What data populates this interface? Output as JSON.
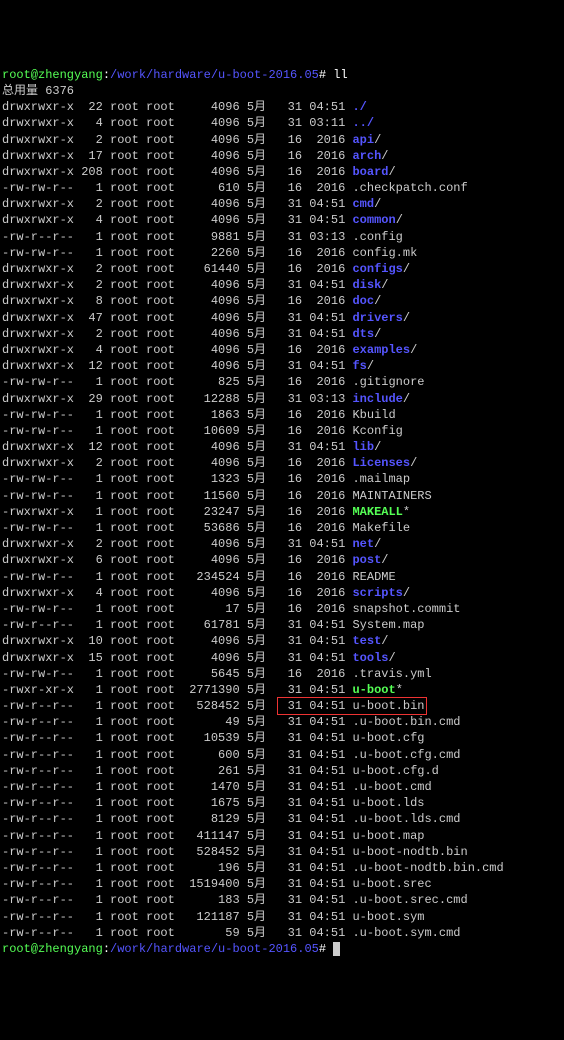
{
  "prompt": {
    "userhost": "root@zhengyang",
    "path": "/work/hardware/u-boot-2016.05",
    "cmd": "ll"
  },
  "total_label": "总用量 6376",
  "rows": [
    {
      "perm": "drwxrwxr-x",
      "links": "22",
      "owner": "root",
      "group": "root",
      "size": "4096",
      "mon": "5月",
      "day": "31",
      "time": "04:51",
      "name": "./",
      "cls": "blue"
    },
    {
      "perm": "drwxrwxr-x",
      "links": "4",
      "owner": "root",
      "group": "root",
      "size": "4096",
      "mon": "5月",
      "day": "31",
      "time": "03:11",
      "name": "../",
      "cls": "blue"
    },
    {
      "perm": "drwxrwxr-x",
      "links": "2",
      "owner": "root",
      "group": "root",
      "size": "4096",
      "mon": "5月",
      "day": "16",
      "time": "2016",
      "name": "api",
      "cls": "blue",
      "trail": "/"
    },
    {
      "perm": "drwxrwxr-x",
      "links": "17",
      "owner": "root",
      "group": "root",
      "size": "4096",
      "mon": "5月",
      "day": "16",
      "time": "2016",
      "name": "arch",
      "cls": "blue",
      "trail": "/"
    },
    {
      "perm": "drwxrwxr-x",
      "links": "208",
      "owner": "root",
      "group": "root",
      "size": "4096",
      "mon": "5月",
      "day": "16",
      "time": "2016",
      "name": "board",
      "cls": "blue",
      "trail": "/"
    },
    {
      "perm": "-rw-rw-r--",
      "links": "1",
      "owner": "root",
      "group": "root",
      "size": "610",
      "mon": "5月",
      "day": "16",
      "time": "2016",
      "name": ".checkpatch.conf",
      "cls": "gray"
    },
    {
      "perm": "drwxrwxr-x",
      "links": "2",
      "owner": "root",
      "group": "root",
      "size": "4096",
      "mon": "5月",
      "day": "31",
      "time": "04:51",
      "name": "cmd",
      "cls": "blue",
      "trail": "/"
    },
    {
      "perm": "drwxrwxr-x",
      "links": "4",
      "owner": "root",
      "group": "root",
      "size": "4096",
      "mon": "5月",
      "day": "31",
      "time": "04:51",
      "name": "common",
      "cls": "blue",
      "trail": "/"
    },
    {
      "perm": "-rw-r--r--",
      "links": "1",
      "owner": "root",
      "group": "root",
      "size": "9881",
      "mon": "5月",
      "day": "31",
      "time": "03:13",
      "name": ".config",
      "cls": "gray"
    },
    {
      "perm": "-rw-rw-r--",
      "links": "1",
      "owner": "root",
      "group": "root",
      "size": "2260",
      "mon": "5月",
      "day": "16",
      "time": "2016",
      "name": "config.mk",
      "cls": "gray"
    },
    {
      "perm": "drwxrwxr-x",
      "links": "2",
      "owner": "root",
      "group": "root",
      "size": "61440",
      "mon": "5月",
      "day": "16",
      "time": "2016",
      "name": "configs",
      "cls": "blue",
      "trail": "/"
    },
    {
      "perm": "drwxrwxr-x",
      "links": "2",
      "owner": "root",
      "group": "root",
      "size": "4096",
      "mon": "5月",
      "day": "31",
      "time": "04:51",
      "name": "disk",
      "cls": "blue",
      "trail": "/"
    },
    {
      "perm": "drwxrwxr-x",
      "links": "8",
      "owner": "root",
      "group": "root",
      "size": "4096",
      "mon": "5月",
      "day": "16",
      "time": "2016",
      "name": "doc",
      "cls": "blue",
      "trail": "/"
    },
    {
      "perm": "drwxrwxr-x",
      "links": "47",
      "owner": "root",
      "group": "root",
      "size": "4096",
      "mon": "5月",
      "day": "31",
      "time": "04:51",
      "name": "drivers",
      "cls": "blue",
      "trail": "/"
    },
    {
      "perm": "drwxrwxr-x",
      "links": "2",
      "owner": "root",
      "group": "root",
      "size": "4096",
      "mon": "5月",
      "day": "31",
      "time": "04:51",
      "name": "dts",
      "cls": "blue",
      "trail": "/"
    },
    {
      "perm": "drwxrwxr-x",
      "links": "4",
      "owner": "root",
      "group": "root",
      "size": "4096",
      "mon": "5月",
      "day": "16",
      "time": "2016",
      "name": "examples",
      "cls": "blue",
      "trail": "/"
    },
    {
      "perm": "drwxrwxr-x",
      "links": "12",
      "owner": "root",
      "group": "root",
      "size": "4096",
      "mon": "5月",
      "day": "31",
      "time": "04:51",
      "name": "fs",
      "cls": "blue",
      "trail": "/"
    },
    {
      "perm": "-rw-rw-r--",
      "links": "1",
      "owner": "root",
      "group": "root",
      "size": "825",
      "mon": "5月",
      "day": "16",
      "time": "2016",
      "name": ".gitignore",
      "cls": "gray"
    },
    {
      "perm": "drwxrwxr-x",
      "links": "29",
      "owner": "root",
      "group": "root",
      "size": "12288",
      "mon": "5月",
      "day": "31",
      "time": "03:13",
      "name": "include",
      "cls": "blue",
      "trail": "/"
    },
    {
      "perm": "-rw-rw-r--",
      "links": "1",
      "owner": "root",
      "group": "root",
      "size": "1863",
      "mon": "5月",
      "day": "16",
      "time": "2016",
      "name": "Kbuild",
      "cls": "gray"
    },
    {
      "perm": "-rw-rw-r--",
      "links": "1",
      "owner": "root",
      "group": "root",
      "size": "10609",
      "mon": "5月",
      "day": "16",
      "time": "2016",
      "name": "Kconfig",
      "cls": "gray"
    },
    {
      "perm": "drwxrwxr-x",
      "links": "12",
      "owner": "root",
      "group": "root",
      "size": "4096",
      "mon": "5月",
      "day": "31",
      "time": "04:51",
      "name": "lib",
      "cls": "blue",
      "trail": "/"
    },
    {
      "perm": "drwxrwxr-x",
      "links": "2",
      "owner": "root",
      "group": "root",
      "size": "4096",
      "mon": "5月",
      "day": "16",
      "time": "2016",
      "name": "Licenses",
      "cls": "blue",
      "trail": "/"
    },
    {
      "perm": "-rw-rw-r--",
      "links": "1",
      "owner": "root",
      "group": "root",
      "size": "1323",
      "mon": "5月",
      "day": "16",
      "time": "2016",
      "name": ".mailmap",
      "cls": "gray"
    },
    {
      "perm": "-rw-rw-r--",
      "links": "1",
      "owner": "root",
      "group": "root",
      "size": "11560",
      "mon": "5月",
      "day": "16",
      "time": "2016",
      "name": "MAINTAINERS",
      "cls": "gray"
    },
    {
      "perm": "-rwxrwxr-x",
      "links": "1",
      "owner": "root",
      "group": "root",
      "size": "23247",
      "mon": "5月",
      "day": "16",
      "time": "2016",
      "name": "MAKEALL",
      "cls": "green",
      "trail": "*"
    },
    {
      "perm": "-rw-rw-r--",
      "links": "1",
      "owner": "root",
      "group": "root",
      "size": "53686",
      "mon": "5月",
      "day": "16",
      "time": "2016",
      "name": "Makefile",
      "cls": "gray"
    },
    {
      "perm": "drwxrwxr-x",
      "links": "2",
      "owner": "root",
      "group": "root",
      "size": "4096",
      "mon": "5月",
      "day": "31",
      "time": "04:51",
      "name": "net",
      "cls": "blue",
      "trail": "/"
    },
    {
      "perm": "drwxrwxr-x",
      "links": "6",
      "owner": "root",
      "group": "root",
      "size": "4096",
      "mon": "5月",
      "day": "16",
      "time": "2016",
      "name": "post",
      "cls": "blue",
      "trail": "/"
    },
    {
      "perm": "-rw-rw-r--",
      "links": "1",
      "owner": "root",
      "group": "root",
      "size": "234524",
      "mon": "5月",
      "day": "16",
      "time": "2016",
      "name": "README",
      "cls": "gray"
    },
    {
      "perm": "drwxrwxr-x",
      "links": "4",
      "owner": "root",
      "group": "root",
      "size": "4096",
      "mon": "5月",
      "day": "16",
      "time": "2016",
      "name": "scripts",
      "cls": "blue",
      "trail": "/"
    },
    {
      "perm": "-rw-rw-r--",
      "links": "1",
      "owner": "root",
      "group": "root",
      "size": "17",
      "mon": "5月",
      "day": "16",
      "time": "2016",
      "name": "snapshot.commit",
      "cls": "gray"
    },
    {
      "perm": "-rw-r--r--",
      "links": "1",
      "owner": "root",
      "group": "root",
      "size": "61781",
      "mon": "5月",
      "day": "31",
      "time": "04:51",
      "name": "System.map",
      "cls": "gray"
    },
    {
      "perm": "drwxrwxr-x",
      "links": "10",
      "owner": "root",
      "group": "root",
      "size": "4096",
      "mon": "5月",
      "day": "31",
      "time": "04:51",
      "name": "test",
      "cls": "blue",
      "trail": "/"
    },
    {
      "perm": "drwxrwxr-x",
      "links": "15",
      "owner": "root",
      "group": "root",
      "size": "4096",
      "mon": "5月",
      "day": "31",
      "time": "04:51",
      "name": "tools",
      "cls": "blue",
      "trail": "/"
    },
    {
      "perm": "-rw-rw-r--",
      "links": "1",
      "owner": "root",
      "group": "root",
      "size": "5645",
      "mon": "5月",
      "day": "16",
      "time": "2016",
      "name": ".travis.yml",
      "cls": "gray"
    },
    {
      "perm": "-rwxr-xr-x",
      "links": "1",
      "owner": "root",
      "group": "root",
      "size": "2771390",
      "mon": "5月",
      "day": "31",
      "time": "04:51",
      "name": "u-boot",
      "cls": "green",
      "trail": "*"
    },
    {
      "perm": "-rw-r--r--",
      "links": "1",
      "owner": "root",
      "group": "root",
      "size": "528452",
      "mon": "5月",
      "day": "31",
      "time": "04:51",
      "name": "u-boot.bin",
      "cls": "gray",
      "hl": true
    },
    {
      "perm": "-rw-r--r--",
      "links": "1",
      "owner": "root",
      "group": "root",
      "size": "49",
      "mon": "5月",
      "day": "31",
      "time": "04:51",
      "name": ".u-boot.bin.cmd",
      "cls": "gray"
    },
    {
      "perm": "-rw-r--r--",
      "links": "1",
      "owner": "root",
      "group": "root",
      "size": "10539",
      "mon": "5月",
      "day": "31",
      "time": "04:51",
      "name": "u-boot.cfg",
      "cls": "gray"
    },
    {
      "perm": "-rw-r--r--",
      "links": "1",
      "owner": "root",
      "group": "root",
      "size": "600",
      "mon": "5月",
      "day": "31",
      "time": "04:51",
      "name": ".u-boot.cfg.cmd",
      "cls": "gray"
    },
    {
      "perm": "-rw-r--r--",
      "links": "1",
      "owner": "root",
      "group": "root",
      "size": "261",
      "mon": "5月",
      "day": "31",
      "time": "04:51",
      "name": "u-boot.cfg.d",
      "cls": "gray"
    },
    {
      "perm": "-rw-r--r--",
      "links": "1",
      "owner": "root",
      "group": "root",
      "size": "1470",
      "mon": "5月",
      "day": "31",
      "time": "04:51",
      "name": ".u-boot.cmd",
      "cls": "gray"
    },
    {
      "perm": "-rw-r--r--",
      "links": "1",
      "owner": "root",
      "group": "root",
      "size": "1675",
      "mon": "5月",
      "day": "31",
      "time": "04:51",
      "name": "u-boot.lds",
      "cls": "gray"
    },
    {
      "perm": "-rw-r--r--",
      "links": "1",
      "owner": "root",
      "group": "root",
      "size": "8129",
      "mon": "5月",
      "day": "31",
      "time": "04:51",
      "name": ".u-boot.lds.cmd",
      "cls": "gray"
    },
    {
      "perm": "-rw-r--r--",
      "links": "1",
      "owner": "root",
      "group": "root",
      "size": "411147",
      "mon": "5月",
      "day": "31",
      "time": "04:51",
      "name": "u-boot.map",
      "cls": "gray"
    },
    {
      "perm": "-rw-r--r--",
      "links": "1",
      "owner": "root",
      "group": "root",
      "size": "528452",
      "mon": "5月",
      "day": "31",
      "time": "04:51",
      "name": "u-boot-nodtb.bin",
      "cls": "gray"
    },
    {
      "perm": "-rw-r--r--",
      "links": "1",
      "owner": "root",
      "group": "root",
      "size": "196",
      "mon": "5月",
      "day": "31",
      "time": "04:51",
      "name": ".u-boot-nodtb.bin.cmd",
      "cls": "gray"
    },
    {
      "perm": "-rw-r--r--",
      "links": "1",
      "owner": "root",
      "group": "root",
      "size": "1519400",
      "mon": "5月",
      "day": "31",
      "time": "04:51",
      "name": "u-boot.srec",
      "cls": "gray"
    },
    {
      "perm": "-rw-r--r--",
      "links": "1",
      "owner": "root",
      "group": "root",
      "size": "183",
      "mon": "5月",
      "day": "31",
      "time": "04:51",
      "name": ".u-boot.srec.cmd",
      "cls": "gray"
    },
    {
      "perm": "-rw-r--r--",
      "links": "1",
      "owner": "root",
      "group": "root",
      "size": "121187",
      "mon": "5月",
      "day": "31",
      "time": "04:51",
      "name": "u-boot.sym",
      "cls": "gray"
    },
    {
      "perm": "-rw-r--r--",
      "links": "1",
      "owner": "root",
      "group": "root",
      "size": "59",
      "mon": "5月",
      "day": "31",
      "time": "04:51",
      "name": ".u-boot.sym.cmd",
      "cls": "gray"
    }
  ]
}
